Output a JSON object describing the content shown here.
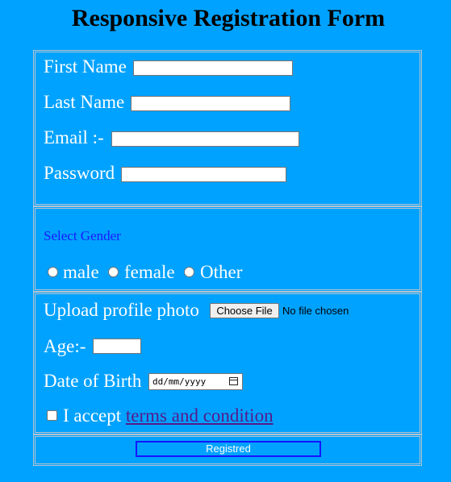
{
  "page": {
    "title": "Responsive Registration Form"
  },
  "personal": {
    "first_name_label": "First Name",
    "last_name_label": "Last Name",
    "email_label": "Email :-",
    "password_label": "Password"
  },
  "gender": {
    "heading": "Select Gender",
    "options": [
      "male",
      "female",
      "Other"
    ]
  },
  "extra": {
    "photo_label": "Upload profile photo",
    "choose_file_label": "Choose File",
    "file_status": "No file chosen",
    "age_label": "Age:-",
    "dob_label": "Date of Birth",
    "dob_placeholder": "dd/mm/yyyy",
    "accept_text": "I accept",
    "terms_link": "terms and condition"
  },
  "submit": {
    "label": "Registred"
  }
}
